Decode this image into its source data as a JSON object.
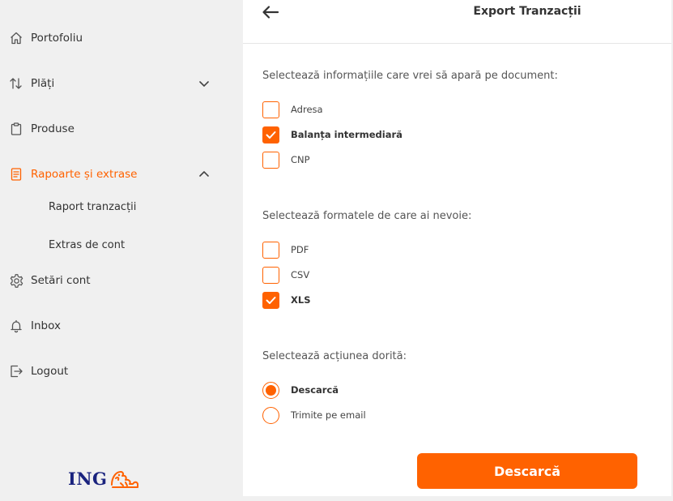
{
  "brand": {
    "accent": "#ff6200",
    "logo_text": "ING",
    "logo_color": "#1a237e"
  },
  "sidebar": {
    "items": [
      {
        "label": "Portofoliu",
        "icon": "home-icon"
      },
      {
        "label": "Plăți",
        "icon": "transfer-arrows-icon",
        "chevron": "chevron-down-icon"
      },
      {
        "label": "Produse",
        "icon": "clipboard-icon"
      },
      {
        "label": "Rapoarte și extrase",
        "icon": "document-icon",
        "chevron": "chevron-up-icon",
        "active": true
      },
      {
        "label": "Setări cont",
        "icon": "gear-icon"
      },
      {
        "label": "Inbox",
        "icon": "bell-icon"
      },
      {
        "label": "Logout",
        "icon": "logout-icon"
      }
    ],
    "subitems": [
      {
        "label": "Raport tranzacții"
      },
      {
        "label": "Extras de cont"
      }
    ]
  },
  "header": {
    "title": "Export Tranzacții",
    "back_icon": "arrow-left-icon"
  },
  "sections": [
    {
      "label": "Selectează informațiile care vrei să apară pe document:",
      "type": "checkbox",
      "options": [
        {
          "label": "Adresa",
          "checked": false
        },
        {
          "label": "Balanța intermediară",
          "checked": true
        },
        {
          "label": "CNP",
          "checked": false
        }
      ]
    },
    {
      "label": "Selectează formatele de care ai nevoie:",
      "type": "checkbox",
      "options": [
        {
          "label": "PDF",
          "checked": false
        },
        {
          "label": "CSV",
          "checked": false
        },
        {
          "label": "XLS",
          "checked": true
        }
      ]
    },
    {
      "label": "Selectează acțiunea dorită:",
      "type": "radio",
      "options": [
        {
          "label": "Descarcă",
          "checked": true
        },
        {
          "label": "Trimite pe email",
          "checked": false
        }
      ]
    }
  ],
  "action": {
    "label": "Descarcă"
  }
}
